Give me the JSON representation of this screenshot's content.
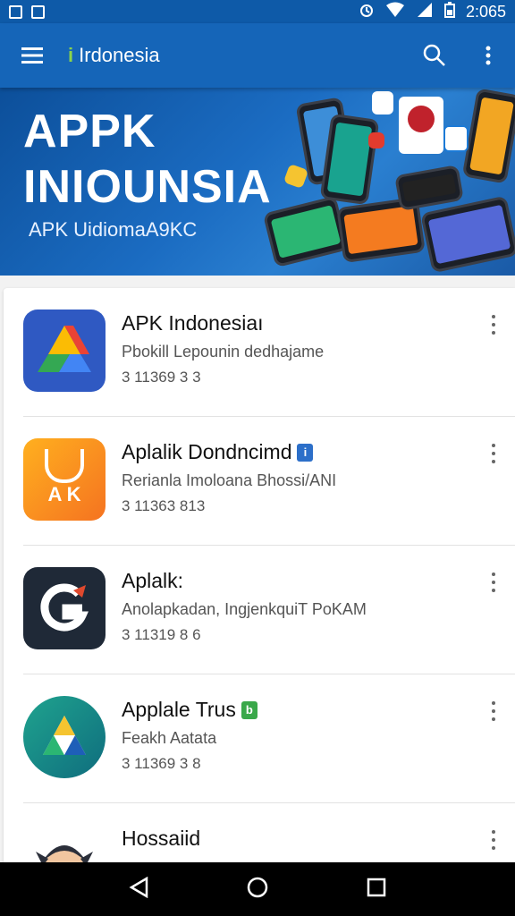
{
  "status_bar": {
    "time": "2:065"
  },
  "app_bar": {
    "title": "Irdonesia",
    "title_accent": "i"
  },
  "banner": {
    "title_line1": "APPK",
    "title_line2": "INIOUNSIA",
    "subtitle": "APK UidiomaA9KC"
  },
  "apps": [
    {
      "title": "APK Indonesiaı",
      "subtitle": "Pbokill Lepounin dedhajame",
      "meta": "3 11369 3 3",
      "badge": ""
    },
    {
      "title": "Aplalik Dondncimd",
      "subtitle": "Rerianla Imoloana Bhossi/ANI",
      "meta": "3 11363 813",
      "badge": "i",
      "badge_color": "#2c6fc9",
      "icon_text": "A K"
    },
    {
      "title": "Aplalk:",
      "subtitle": "Anolapkadan, IngjenkquiT PoKAM",
      "meta": "3 11319 8 6",
      "badge": ""
    },
    {
      "title": "Applale Trus",
      "subtitle": "Feakh Aatata",
      "meta": "3 11369 3 8",
      "badge": "b",
      "badge_color": "#3aa84a"
    },
    {
      "title": "Hossaiid",
      "subtitle": "",
      "meta": "",
      "badge": ""
    }
  ]
}
